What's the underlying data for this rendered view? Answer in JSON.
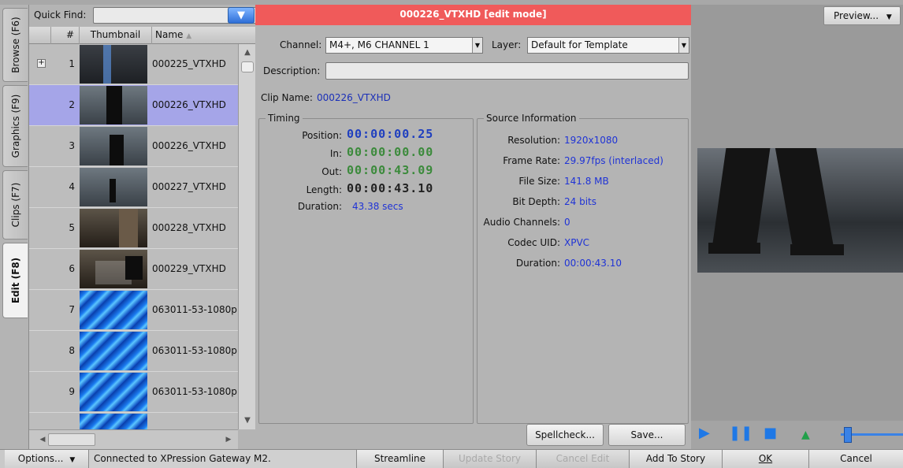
{
  "vtabs": {
    "browse": "Browse (F6)",
    "graphics": "Graphics (F9)",
    "clips": "Clips (F7)",
    "edit": "Edit (F8)"
  },
  "quick_find": {
    "label": "Quick Find:",
    "value": ""
  },
  "list": {
    "columns": {
      "num": "#",
      "thumbnail": "Thumbnail",
      "name": "Name"
    },
    "rows": [
      {
        "num": "1",
        "name": "000225_VTXHD"
      },
      {
        "num": "2",
        "name": "000226_VTXHD"
      },
      {
        "num": "3",
        "name": "000226_VTXHD"
      },
      {
        "num": "4",
        "name": "000227_VTXHD"
      },
      {
        "num": "5",
        "name": "000228_VTXHD"
      },
      {
        "num": "6",
        "name": "000229_VTXHD"
      },
      {
        "num": "7",
        "name": "063011-53-1080p"
      },
      {
        "num": "8",
        "name": "063011-53-1080p"
      },
      {
        "num": "9",
        "name": "063011-53-1080p"
      }
    ],
    "selected_row": 2
  },
  "edit": {
    "title": "000226_VTXHD [edit mode]",
    "channel_label": "Channel:",
    "channel_value": "M4+, M6 CHANNEL 1",
    "layer_label": "Layer:",
    "layer_value": "Default for Template",
    "description_label": "Description:",
    "description_value": "",
    "clip_name_label": "Clip Name:",
    "clip_name_value": "000226_VTXHD",
    "timing": {
      "title": "Timing",
      "position_label": "Position:",
      "position": "00:00:00.25",
      "in_label": "In:",
      "in": "00:00:00.00",
      "out_label": "Out:",
      "out": "00:00:43.09",
      "length_label": "Length:",
      "length": "00:00:43.10",
      "duration_label": "Duration:",
      "duration": "43.38 secs"
    },
    "source": {
      "title": "Source Information",
      "resolution_label": "Resolution:",
      "resolution": "1920x1080",
      "frame_rate_label": "Frame Rate:",
      "frame_rate": "29.97fps (interlaced)",
      "file_size_label": "File Size:",
      "file_size": "141.8 MB",
      "bit_depth_label": "Bit Depth:",
      "bit_depth": "24 bits",
      "audio_label": "Audio Channels:",
      "audio": "0",
      "codec_label": "Codec UID:",
      "codec": "XPVC",
      "duration_label": "Duration:",
      "duration": "00:00:43.10"
    },
    "spellcheck": "Spellcheck...",
    "save": "Save..."
  },
  "preview": {
    "button": "Preview..."
  },
  "bottom": {
    "options": "Options...",
    "status": "Connected to XPression Gateway M2.",
    "streamline": "Streamline",
    "update_story": "Update Story",
    "cancel_edit": "Cancel Edit",
    "add_to_story": "Add To Story",
    "ok": "OK",
    "cancel": "Cancel"
  },
  "colors": {
    "title_bar": "#f05a5a",
    "selected_row": "#a5a5e8",
    "timecode_blue": "#1f3fbf",
    "timecode_green": "#3b8a3b"
  }
}
